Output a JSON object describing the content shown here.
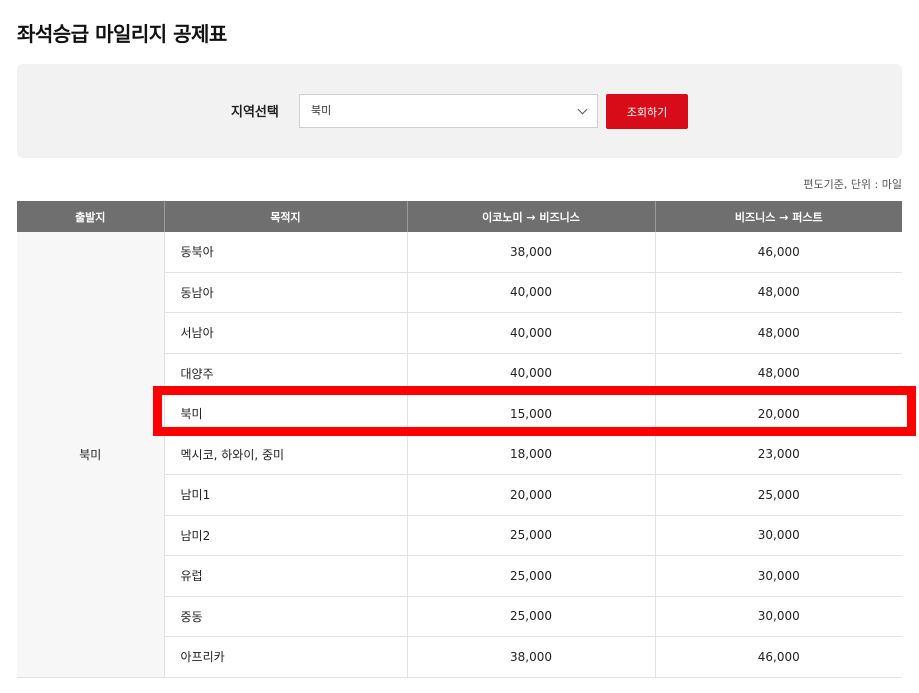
{
  "page": {
    "title": "좌석승급 마일리지 공제표"
  },
  "filter": {
    "label": "지역선택",
    "selected_region": "북미",
    "search_label": "조회하기"
  },
  "unit_note": "편도기준, 단위 : 마일",
  "table": {
    "headers": [
      "출발지",
      "목적지",
      "이코노미 → 비즈니스",
      "비즈니스 → 퍼스트"
    ],
    "origin": "북미",
    "rows": [
      {
        "destination": "동북아",
        "economy_to_business": "38,000",
        "business_to_first": "46,000"
      },
      {
        "destination": "동남아",
        "economy_to_business": "40,000",
        "business_to_first": "48,000"
      },
      {
        "destination": "서남아",
        "economy_to_business": "40,000",
        "business_to_first": "48,000"
      },
      {
        "destination": "대양주",
        "economy_to_business": "40,000",
        "business_to_first": "48,000"
      },
      {
        "destination": "북미",
        "economy_to_business": "15,000",
        "business_to_first": "20,000"
      },
      {
        "destination": "멕시코, 하와이, 중미",
        "economy_to_business": "18,000",
        "business_to_first": "23,000"
      },
      {
        "destination": "남미1",
        "economy_to_business": "20,000",
        "business_to_first": "25,000"
      },
      {
        "destination": "남미2",
        "economy_to_business": "25,000",
        "business_to_first": "30,000"
      },
      {
        "destination": "유럽",
        "economy_to_business": "25,000",
        "business_to_first": "30,000"
      },
      {
        "destination": "중동",
        "economy_to_business": "25,000",
        "business_to_first": "30,000"
      },
      {
        "destination": "아프리카",
        "economy_to_business": "38,000",
        "business_to_first": "46,000"
      }
    ]
  },
  "colors": {
    "accent": "#d80b18",
    "header_bg": "#6f6f6f",
    "highlight": "#ff0000"
  },
  "icons": {
    "select_chevron": "chevron-down-icon"
  }
}
